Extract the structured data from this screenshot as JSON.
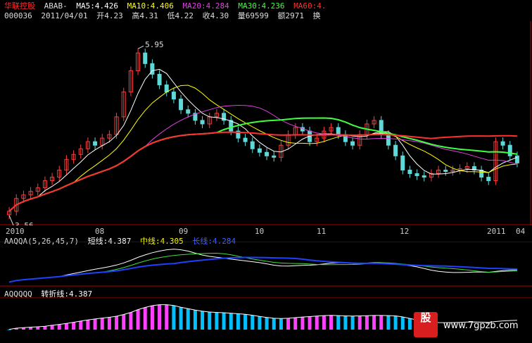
{
  "header": {
    "stock_name": "华联控股",
    "indicator_name": "ABAB-",
    "ma5": "MA5:4.426",
    "ma10": "MA10:4.406",
    "ma20": "MA20:4.284",
    "ma30": "MA30:4.236",
    "ma60": "MA60:4.",
    "code": "000036",
    "date": "2011/04/01",
    "open": "开4.23",
    "high": "高4.31",
    "low": "低4.22",
    "close": "收4.30",
    "volume": "量69599",
    "amount": "额2971",
    "turnover": "换"
  },
  "indicator1": {
    "name": "AAQQA(5,26,45,7)",
    "short": "短线:4.387",
    "mid": "中线:4.305",
    "long": "长线:4.284"
  },
  "indicator2": {
    "name": "AQQQQQ",
    "turn": "转折线:4.387"
  },
  "annotations": {
    "high_label": "5.95",
    "low_label": "3.56"
  },
  "watermark": {
    "logo": "股",
    "url": "www.7gpzb.com"
  },
  "colors": {
    "up": "#ff3c3c",
    "down": "#5fd8d8",
    "ma5": "#ffffff",
    "ma10": "#ffff00",
    "ma20": "#e040e0",
    "ma30": "#40ff40",
    "ma60": "#ff3030",
    "ma_blue": "#8080ff",
    "long_green": "#40e040",
    "up_bar": "#ff40ff",
    "down_bar": "#00c0ff"
  },
  "chart_data": {
    "type": "candlestick",
    "x_labels": [
      "2010",
      "08",
      "09",
      "10",
      "11",
      "12",
      "2011",
      "04"
    ],
    "ylim": [
      3.5,
      6.1
    ],
    "closes": [
      3.62,
      3.8,
      3.85,
      3.9,
      3.95,
      4.05,
      4.1,
      4.2,
      4.35,
      4.42,
      4.5,
      4.6,
      4.55,
      4.65,
      4.7,
      4.95,
      5.3,
      5.6,
      5.85,
      5.7,
      5.55,
      5.4,
      5.3,
      5.2,
      5.05,
      5.0,
      4.9,
      4.85,
      4.95,
      5.0,
      4.9,
      4.75,
      4.65,
      4.6,
      4.5,
      4.45,
      4.4,
      4.38,
      4.55,
      4.7,
      4.8,
      4.75,
      4.6,
      4.65,
      4.75,
      4.8,
      4.7,
      4.6,
      4.55,
      4.7,
      4.85,
      4.9,
      4.7,
      4.55,
      4.4,
      4.2,
      4.15,
      4.12,
      4.1,
      4.15,
      4.2,
      4.18,
      4.2,
      4.22,
      4.25,
      4.2,
      4.1,
      4.05,
      4.6,
      4.55,
      4.4,
      4.3
    ]
  }
}
